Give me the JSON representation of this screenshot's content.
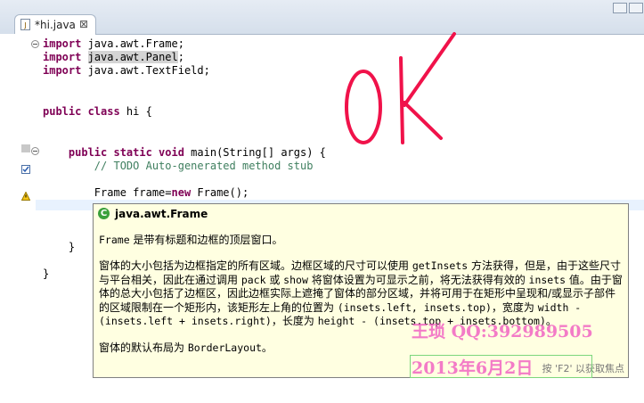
{
  "editor": {
    "tab": {
      "label": "*hi.java",
      "close": "⊠",
      "file_icon": "J"
    },
    "code_lines": [
      {
        "kw": "import",
        "text": " java.awt.Frame;"
      },
      {
        "kw": "import",
        "pre": " ",
        "hl": "java.awt.Panel",
        "text": ";"
      },
      {
        "kw": "import",
        "text": " java.awt.TextField;"
      },
      {},
      {},
      {
        "kw": "public class",
        "text": " hi {"
      },
      {},
      {},
      {
        "indent": "    ",
        "kw": "public static void",
        "text": " main(String[] args) {"
      },
      {
        "indent": "        ",
        "comment": "// TODO Auto-generated method stub"
      },
      {},
      {
        "indent": "        ",
        "text": "Frame frame=",
        "kw2": "new",
        "text2": " Frame();"
      },
      {},
      {},
      {},
      {
        "indent": "    ",
        "text": "}"
      },
      {},
      {
        "text": "}"
      }
    ]
  },
  "handwriting": {
    "text": "OK",
    "color": "#f0124a"
  },
  "javadoc": {
    "title": "java.awt.Frame",
    "para1_pre": "Frame",
    "para1_post": " 是带有标题和边框的顶层窗口。",
    "para2": [
      {
        "t": "窗体的大小包括为边框指定的所有区域。边框区域的尺寸可以使用 ",
        "m": false
      },
      {
        "t": "getInsets",
        "m": true
      },
      {
        "t": " 方法获得，但是，由于这些尺寸与平台相关，因此在通过调用 ",
        "m": false
      },
      {
        "t": "pack",
        "m": true
      },
      {
        "t": " 或 ",
        "m": false
      },
      {
        "t": "show",
        "m": true
      },
      {
        "t": " 将窗体设置为可显示之前，将无法获得有效的 ",
        "m": false
      },
      {
        "t": "insets",
        "m": true
      },
      {
        "t": " 值。由于窗体的总大小包括了边框区，因此边框实际上遮掩了窗体的部分区域，并将可用于在矩形中呈现和/或显示子部件的区域限制在一个矩形内，该矩形左上角的位置为 ",
        "m": false
      },
      {
        "t": "(insets.left, insets.top)",
        "m": true
      },
      {
        "t": "，宽度为 ",
        "m": false
      },
      {
        "t": "width - (insets.left + insets.right)",
        "m": true
      },
      {
        "t": "，长度为 ",
        "m": false
      },
      {
        "t": "height - (insets.top + insets.bottom)",
        "m": true
      },
      {
        "t": "。",
        "m": false
      }
    ],
    "para3_pre": "窗体的默认布局为 ",
    "para3_code": "BorderLayout",
    "para3_post": "。",
    "hint": "按 'F2' 以获取焦点"
  },
  "watermark": {
    "line1": "王琐 QQ:392989505",
    "line2": "2013年6月2日"
  },
  "colors": {
    "keyword": "#7f0055",
    "comment": "#3f7f5f",
    "popup_bg": "#ffffe1"
  }
}
